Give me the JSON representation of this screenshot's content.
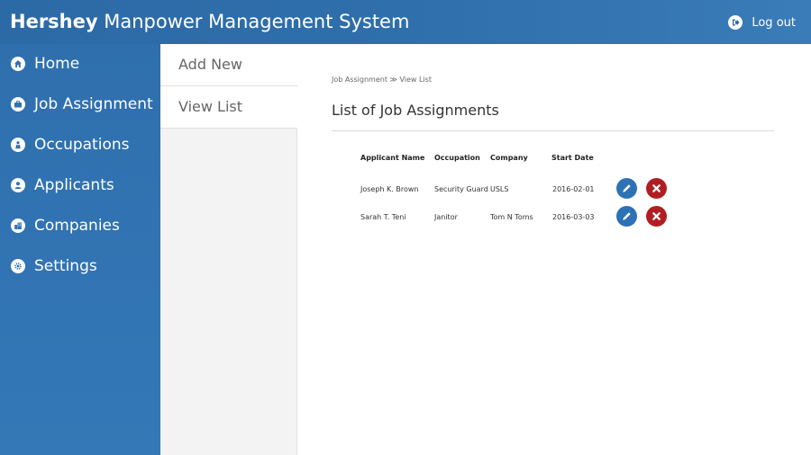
{
  "header": {
    "brand": "Hershey",
    "title_rest": " Manpower Management System",
    "logout_label": "Log out"
  },
  "sidebar": {
    "items": [
      {
        "label": "Home",
        "icon": "home-icon"
      },
      {
        "label": "Job Assignment",
        "icon": "briefcase-icon"
      },
      {
        "label": "Occupations",
        "icon": "worker-icon"
      },
      {
        "label": "Applicants",
        "icon": "user-icon"
      },
      {
        "label": "Companies",
        "icon": "building-icon"
      },
      {
        "label": "Settings",
        "icon": "gear-icon"
      }
    ]
  },
  "submenu": {
    "items": [
      {
        "label": "Add New"
      },
      {
        "label": "View List"
      }
    ]
  },
  "main": {
    "breadcrumb": {
      "parent": "Job Assignment",
      "separator": "≫",
      "current": "View List"
    },
    "page_title": "List of Job Assignments",
    "table": {
      "columns": [
        "Applicant Name",
        "Occupation",
        "Company",
        "Start Date"
      ],
      "rows": [
        {
          "applicant": "Joseph K. Brown",
          "occupation": "Security Guard",
          "company": "USLS",
          "start_date": "2016-02-01"
        },
        {
          "applicant": "Sarah T. Teni",
          "occupation": "Janitor",
          "company": "Tom N Toms",
          "start_date": "2016-03-03"
        }
      ]
    }
  },
  "colors": {
    "header_blue": "#2c6aa6",
    "sidebar_blue": "#3478b7",
    "edit_blue": "#2d72b5",
    "delete_red": "#b01e23"
  }
}
